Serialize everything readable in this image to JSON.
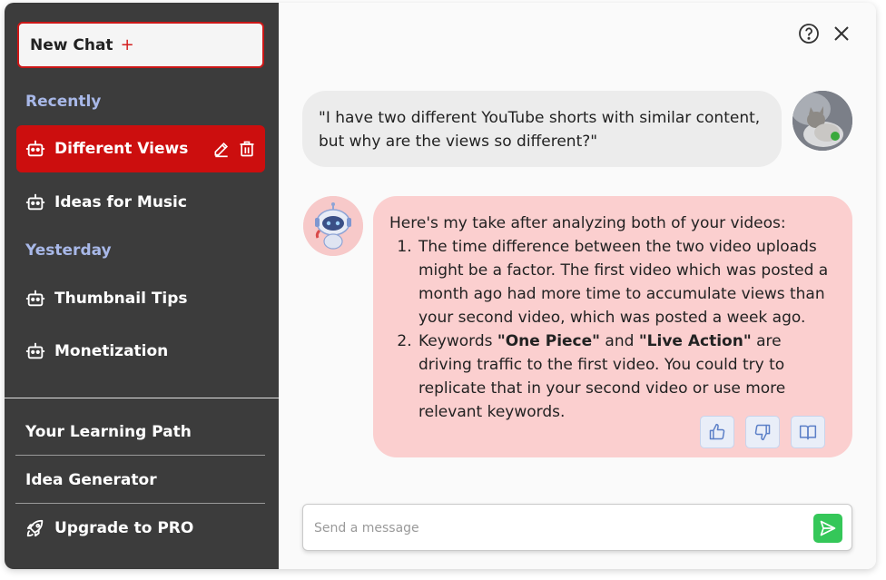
{
  "sidebar": {
    "new_chat_label": "New Chat",
    "new_chat_plus": "+",
    "sections": [
      {
        "title": "Recently",
        "items": [
          "Different Views",
          "Ideas for Music"
        ]
      },
      {
        "title": "Yesterday",
        "items": [
          "Thumbnail Tips",
          "Monetization"
        ]
      }
    ],
    "footer": {
      "learning_path": "Your Learning Path",
      "idea_generator": "Idea Generator",
      "upgrade": "Upgrade to PRO"
    }
  },
  "conversation": {
    "user_message": "\"I have two different YouTube shorts with similar content, but why are the views so different?\"",
    "bot_intro": "Here's my take after analyzing both of your videos:",
    "bot_point1": "The time difference between the two video uploads might be a factor. The first video which was posted a month ago had more time to accumulate views than your second video, which was posted a week ago.",
    "bot_point2_a": "Keywords ",
    "bot_point2_kw1": "\"One Piece\"",
    "bot_point2_b": " and ",
    "bot_point2_kw2": "\"Live Action\"",
    "bot_point2_c": " are driving traffic to the first video. You could try to replicate that in your second video or use more relevant keywords."
  },
  "input": {
    "placeholder": "Send a message"
  },
  "colors": {
    "sidebar_bg": "#3c3c3c",
    "accent_red": "#cc0e0e",
    "section_title": "#a8b8e8",
    "bot_bubble": "#fbcfcf",
    "user_bubble": "#ececec",
    "send_green": "#35c759"
  },
  "icons": [
    "plus-icon",
    "robot-icon",
    "edit-icon",
    "trash-icon",
    "rocket-icon",
    "help-icon",
    "close-icon",
    "thumbs-up-icon",
    "thumbs-down-icon",
    "book-icon",
    "send-icon"
  ]
}
